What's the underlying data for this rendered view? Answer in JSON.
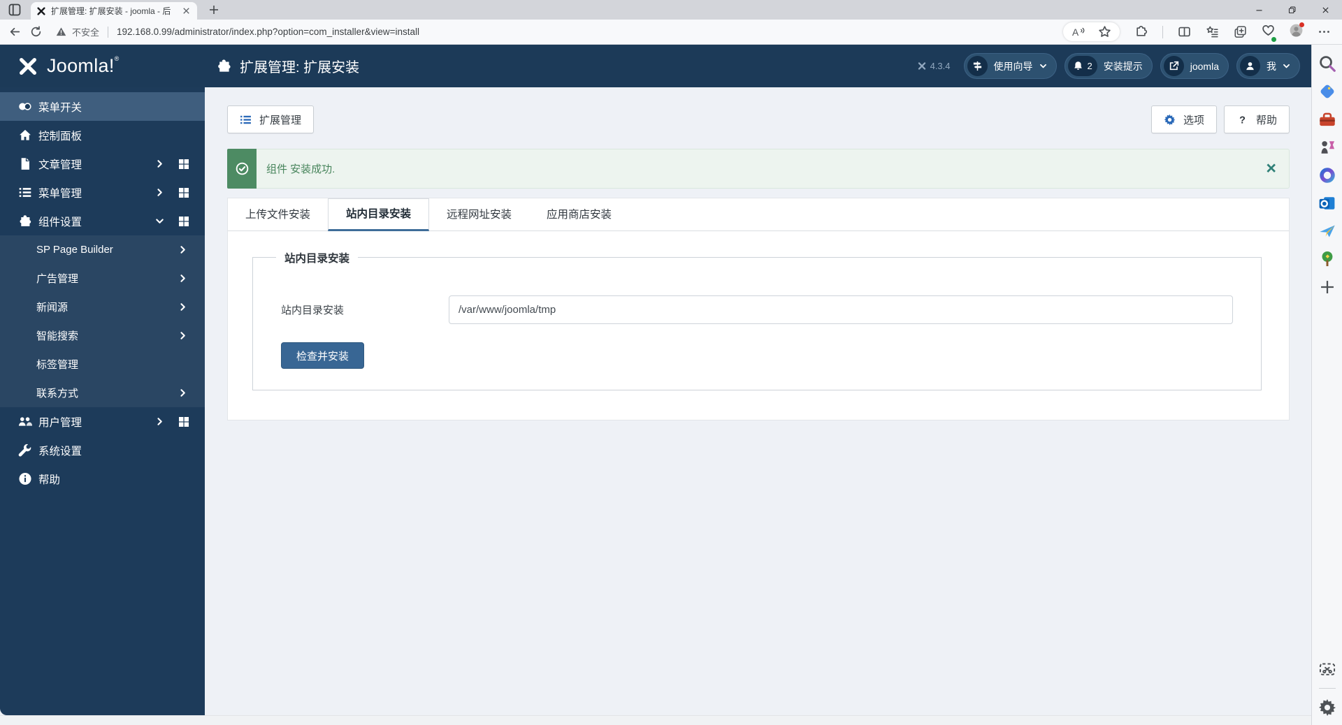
{
  "browser": {
    "tab_title": "扩展管理: 扩展安装 - joomla - 后",
    "security_label": "不安全",
    "url": "192.168.0.99/administrator/index.php?option=com_installer&view=install",
    "nav_icons": [
      "back",
      "refresh"
    ],
    "toolbar_right_icons": [
      "read-aloud",
      "star",
      "extensions",
      "split-screen",
      "favorites",
      "collections",
      "browser-essentials",
      "profile",
      "more"
    ],
    "window_controls": [
      "minimize",
      "restore",
      "close"
    ]
  },
  "header": {
    "logo": "Joomla!",
    "logo_reg": "®",
    "page_title": "扩展管理: 扩展安装",
    "version": "4.3.4",
    "pills": [
      {
        "icon": "signpost",
        "label": "使用向导",
        "chevron": true
      },
      {
        "icon": "bell",
        "badge": "2",
        "label": "安装提示"
      },
      {
        "icon": "external-link",
        "label": "joomla"
      },
      {
        "icon": "person",
        "label": "我",
        "chevron": true
      }
    ]
  },
  "sidebar": {
    "items": [
      {
        "label": "菜单开关",
        "icon": "toggle",
        "active": true
      },
      {
        "label": "控制面板",
        "icon": "home"
      },
      {
        "label": "文章管理",
        "icon": "file",
        "chevron": "right",
        "grid": true
      },
      {
        "label": "菜单管理",
        "icon": "list",
        "chevron": "right",
        "grid": true
      },
      {
        "label": "组件设置",
        "icon": "puzzle",
        "chevron": "down",
        "grid": true
      },
      {
        "label": "SP Page Builder",
        "sub": true,
        "chevron": "right"
      },
      {
        "label": "广告管理",
        "sub": true,
        "chevron": "right"
      },
      {
        "label": "新闻源",
        "sub": true,
        "chevron": "right"
      },
      {
        "label": "智能搜索",
        "sub": true,
        "chevron": "right"
      },
      {
        "label": "标签管理",
        "sub": true
      },
      {
        "label": "联系方式",
        "sub": true,
        "chevron": "right"
      },
      {
        "label": "用户管理",
        "icon": "users",
        "chevron": "right",
        "grid": true
      },
      {
        "label": "系统设置",
        "icon": "wrench"
      },
      {
        "label": "帮助",
        "icon": "info"
      }
    ]
  },
  "content": {
    "toolbar": {
      "back_label": "扩展管理",
      "options_label": "选项",
      "help_label": "帮助"
    },
    "alert": {
      "message": "组件 安装成功.",
      "close": "×"
    },
    "tabs": [
      {
        "label": "上传文件安装"
      },
      {
        "label": "站内目录安装",
        "active": true
      },
      {
        "label": "远程网址安装"
      },
      {
        "label": "应用商店安装"
      }
    ],
    "form": {
      "legend": "站内目录安装",
      "field_label": "站内目录安装",
      "field_value": "/var/www/joomla/tmp",
      "submit_label": "检查并安装"
    }
  },
  "edge_sidebar": {
    "top_icons": [
      "search",
      "shopping",
      "toolbox",
      "games",
      "microsoft-loop",
      "outlook",
      "drop",
      "tree",
      "add"
    ],
    "bottom_icons": [
      "screenshot",
      "settings"
    ]
  },
  "colors": {
    "header_bg": "#1c3a58",
    "sidebar_bg": "#1d3b5a",
    "active_item_bg": "#3f5e7e",
    "accent_blue": "#2a69b8",
    "primary_button": "#386694",
    "alert_green": "#4d8b63",
    "tab_underline": "#3f6d99"
  }
}
